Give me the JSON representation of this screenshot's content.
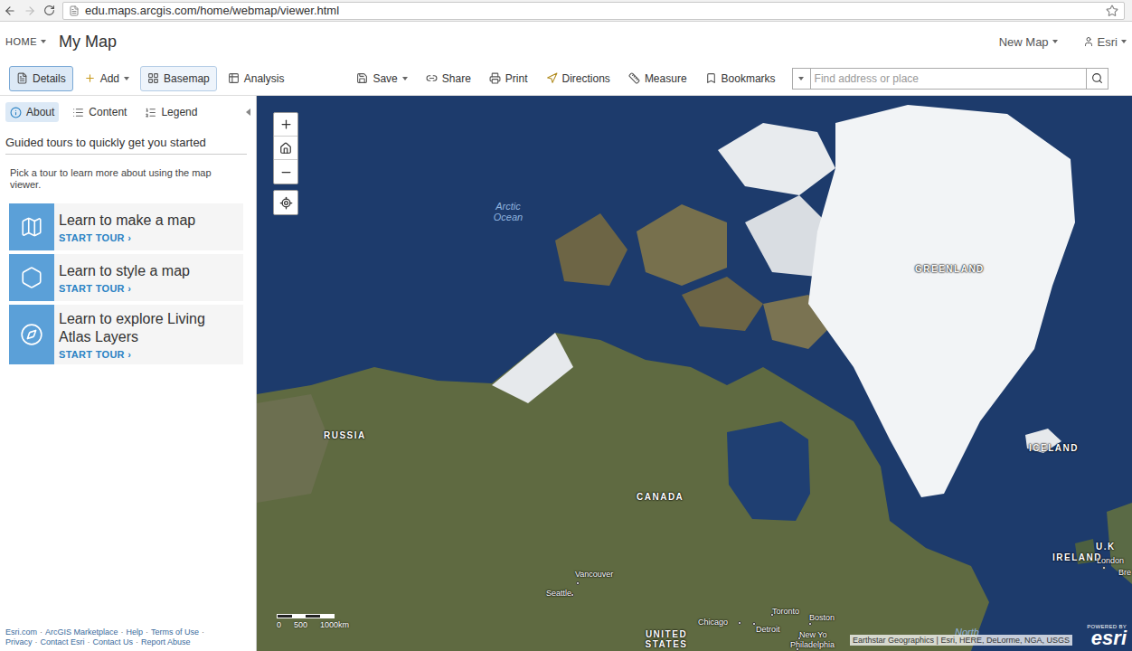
{
  "browser": {
    "url": "edu.maps.arcgis.com/home/webmap/viewer.html",
    "back_enabled": true,
    "forward_enabled": false
  },
  "header": {
    "home": "HOME",
    "title": "My Map",
    "new_map": "New Map",
    "user": "Esri"
  },
  "toolbar": [
    {
      "label": "Details",
      "icon": "details",
      "dropdown": false,
      "selected": true,
      "hovered": false
    },
    {
      "label": "Add",
      "icon": "add",
      "dropdown": true,
      "selected": false,
      "hovered": false
    },
    {
      "label": "Basemap",
      "icon": "basemap",
      "dropdown": false,
      "selected": false,
      "hovered": true
    },
    {
      "label": "Analysis",
      "icon": "analysis",
      "dropdown": false,
      "selected": false,
      "hovered": false
    },
    {
      "label": "Save",
      "icon": "save",
      "dropdown": true,
      "selected": false,
      "hovered": false
    },
    {
      "label": "Share",
      "icon": "share",
      "dropdown": false,
      "selected": false,
      "hovered": false
    },
    {
      "label": "Print",
      "icon": "print",
      "dropdown": false,
      "selected": false,
      "hovered": false
    },
    {
      "label": "Directions",
      "icon": "directions",
      "dropdown": false,
      "selected": false,
      "hovered": false
    },
    {
      "label": "Measure",
      "icon": "measure",
      "dropdown": false,
      "selected": false,
      "hovered": false
    },
    {
      "label": "Bookmarks",
      "icon": "bookmarks",
      "dropdown": false,
      "selected": false,
      "hovered": false
    }
  ],
  "search": {
    "placeholder": "Find address or place"
  },
  "panel": {
    "tabs": [
      {
        "label": "About",
        "icon": "about",
        "selected": true
      },
      {
        "label": "Content",
        "icon": "content",
        "selected": false
      },
      {
        "label": "Legend",
        "icon": "legend",
        "selected": false
      }
    ],
    "heading": "Guided tours to quickly get you started",
    "intro": "Pick a tour to learn more about using the map viewer.",
    "tours": [
      {
        "title": "Learn to make a map",
        "action": "START TOUR ›",
        "icon": "map"
      },
      {
        "title": "Learn to style a map",
        "action": "START TOUR ›",
        "icon": "style"
      },
      {
        "title": "Learn to explore Living Atlas Layers",
        "action": "START TOUR ›",
        "icon": "compass"
      }
    ],
    "footer": [
      [
        {
          "text": "Esri.com",
          "kind": "link"
        },
        {
          "text": "·",
          "kind": "sep"
        },
        {
          "text": "ArcGIS Marketplace",
          "kind": "link"
        },
        {
          "text": "·",
          "kind": "sep"
        },
        {
          "text": "Help",
          "kind": "link"
        },
        {
          "text": "·",
          "kind": "sep"
        },
        {
          "text": "Terms of Use",
          "kind": "link"
        },
        {
          "text": "·",
          "kind": "sep"
        }
      ],
      [
        {
          "text": "Privacy",
          "kind": "link"
        },
        {
          "text": "·",
          "kind": "sep"
        },
        {
          "text": "Contact Esri",
          "kind": "link"
        },
        {
          "text": "·",
          "kind": "sep"
        },
        {
          "text": "Contact Us",
          "kind": "link"
        },
        {
          "text": "·",
          "kind": "sep"
        },
        {
          "text": "Report Abuse",
          "kind": "link"
        }
      ]
    ]
  },
  "map": {
    "labels": [
      {
        "text": "Arctic Ocean",
        "kind": "ocean"
      },
      {
        "text": "GREENLAND",
        "kind": "country"
      },
      {
        "text": "RUSSIA",
        "kind": "country"
      },
      {
        "text": "CANADA",
        "kind": "country"
      },
      {
        "text": "ICELAND",
        "kind": "country"
      },
      {
        "text": "IRELAND",
        "kind": "country"
      },
      {
        "text": "U.K",
        "kind": "country"
      },
      {
        "text": "London",
        "kind": "city"
      },
      {
        "text": "Bre",
        "kind": "city"
      },
      {
        "text": "Vancouver",
        "kind": "city"
      },
      {
        "text": "Seattle",
        "kind": "city"
      },
      {
        "text": "Toronto",
        "kind": "city"
      },
      {
        "text": "Boston",
        "kind": "city"
      },
      {
        "text": "Chicago",
        "kind": "city"
      },
      {
        "text": "Detroit",
        "kind": "city"
      },
      {
        "text": "New Yo",
        "kind": "city"
      },
      {
        "text": "Philadelphia",
        "kind": "city"
      },
      {
        "text": "UNITED STATES",
        "kind": "country"
      },
      {
        "text": "North",
        "kind": "ocean"
      }
    ],
    "scale": [
      "0",
      "500",
      "1000km"
    ],
    "attribution": "Earthstar Geographics | Esri, HERE, DeLorme, NGA, USGS",
    "powered": "POWERED BY",
    "logo": "esri"
  }
}
